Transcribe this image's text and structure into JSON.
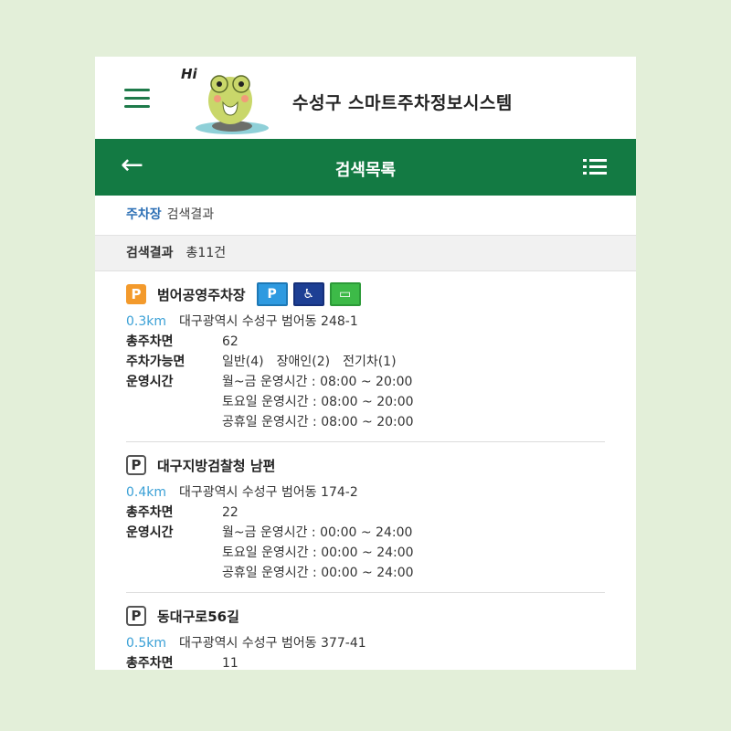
{
  "brand": {
    "hi_text": "Hi",
    "title": "수성구 스마트주차정보시스템"
  },
  "colors": {
    "primary_green": "#137a43",
    "accent_blue": "#2c6fb5",
    "distance_blue": "#3aa0d6",
    "page_bg": "#e3efd9"
  },
  "topbar": {
    "back_icon": "arrow-left-icon",
    "title": "검색목록",
    "list_icon": "list-icon"
  },
  "breadcrumb": {
    "accent": "주차장",
    "rest": "검색결과"
  },
  "summary": {
    "label": "검색결과",
    "count": "총11건"
  },
  "results": [
    {
      "name": "범어공영주차장",
      "icon": "P",
      "facilities": [
        "P",
        "♿",
        "▭"
      ],
      "distance": "0.3km",
      "address": "대구광역시 수성구 범어동 248-1",
      "total_label": "총주차면",
      "total": "62",
      "avail_label": "주차가능면",
      "avail": [
        "일반(4)",
        "장애인(2)",
        "전기차(1)"
      ],
      "hours_label": "운영시간",
      "hours": [
        "월~금 운영시간 : 08:00 ~ 20:00",
        "토요일 운영시간 : 08:00 ~ 20:00",
        "공휴일 운영시간 : 08:00 ~ 20:00"
      ]
    },
    {
      "name": "대구지방검찰청 남편",
      "icon": "P",
      "distance": "0.4km",
      "address": "대구광역시 수성구 범어동 174-2",
      "total_label": "총주차면",
      "total": "22",
      "hours_label": "운영시간",
      "hours": [
        "월~금 운영시간 : 00:00 ~ 24:00",
        "토요일 운영시간 : 00:00 ~ 24:00",
        "공휴일 운영시간 : 00:00 ~ 24:00"
      ]
    },
    {
      "name": "동대구로56길",
      "icon": "P",
      "distance": "0.5km",
      "address": "대구광역시 수성구 범어동 377-41",
      "total_label": "총주차면",
      "total": "11"
    }
  ]
}
